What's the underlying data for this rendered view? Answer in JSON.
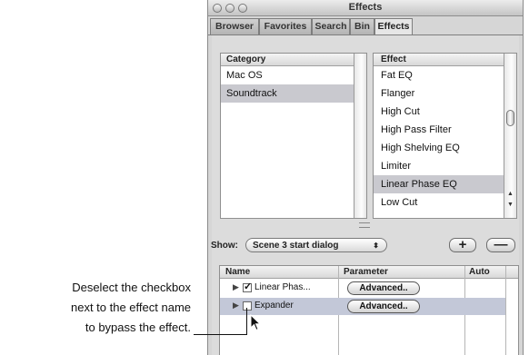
{
  "window": {
    "title": "Effects"
  },
  "tabs": [
    "Browser",
    "Favorites",
    "Search",
    "Bin",
    "Effects"
  ],
  "category_list": {
    "header": "Category",
    "items": [
      "Mac OS",
      "Soundtrack"
    ],
    "selected": "Soundtrack"
  },
  "effect_list": {
    "header": "Effect",
    "items": [
      "Fat EQ",
      "Flanger",
      "High Cut",
      "High Pass Filter",
      "High Shelving EQ",
      "Limiter",
      "Linear Phase EQ",
      "Low Cut"
    ],
    "selected": "Linear Phase EQ"
  },
  "show": {
    "label": "Show:",
    "value": "Scene 3 start dialog",
    "add_label": "+",
    "remove_label": "—"
  },
  "effect_table": {
    "headers": [
      "Name",
      "Parameter",
      "Auto"
    ],
    "rows": [
      {
        "name": "Linear Phas...",
        "checked": true,
        "parameter": "Advanced.."
      },
      {
        "name": "Expander",
        "checked": false,
        "parameter": "Advanced.."
      }
    ]
  },
  "callout": {
    "line1": "Deselect the checkbox",
    "line2": "next to the effect name",
    "line3": "to bypass the effect."
  }
}
